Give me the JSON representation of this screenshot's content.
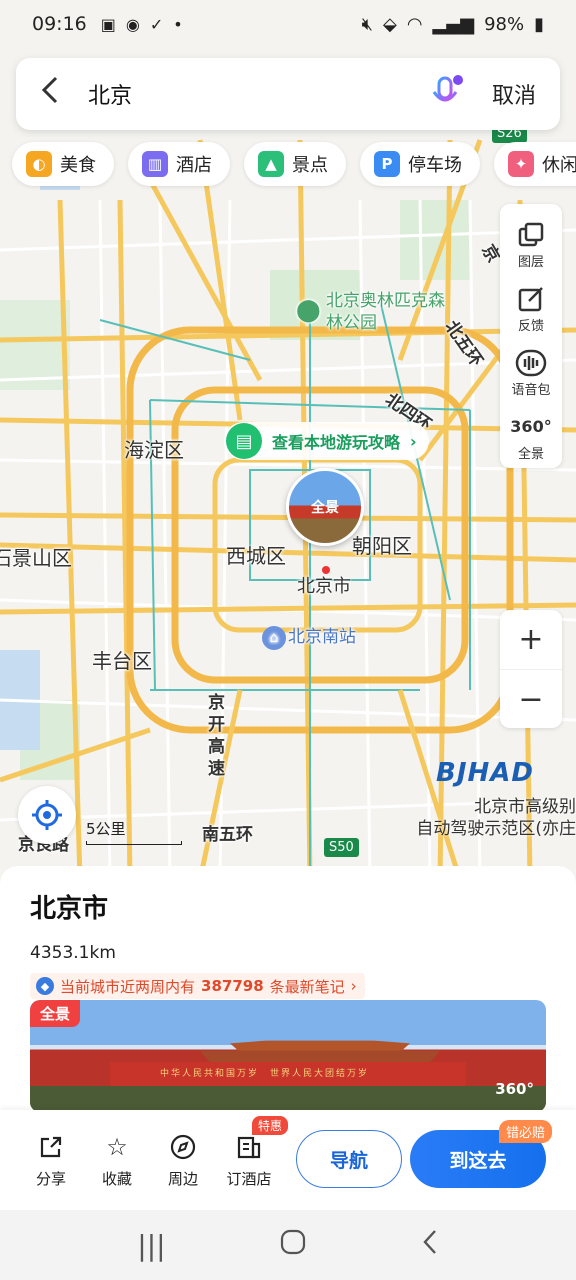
{
  "status_bar": {
    "time": "09:16",
    "battery": "98%",
    "icons": [
      "image-icon",
      "chat-icon",
      "check-icon",
      "dot-icon",
      "mute-icon",
      "location-icon",
      "wifi-icon",
      "signal-icon",
      "battery-icon"
    ]
  },
  "search": {
    "query": "北京",
    "cancel_label": "取消",
    "back_icon": "back-arrow-icon",
    "voice_icon": "mic-icon"
  },
  "categories": [
    {
      "label": "美食",
      "icon": "food-icon",
      "color": "#f5a623"
    },
    {
      "label": "酒店",
      "icon": "hotel-icon",
      "color": "#7b6cf0"
    },
    {
      "label": "景点",
      "icon": "scenic-icon",
      "color": "#2bbf7a"
    },
    {
      "label": "停车场",
      "icon": "parking-icon",
      "color": "#3a8cf2"
    },
    {
      "label": "休闲",
      "icon": "game-icon",
      "color": "#f0607e"
    }
  ],
  "tools": {
    "layers": "图层",
    "feedback": "反馈",
    "voice_pack": "语音包",
    "panorama": "全景",
    "panorama_badge": "360°"
  },
  "map": {
    "labels": {
      "forest_park": "北京奥林匹克森林公园",
      "north_5th_ring": "北五环",
      "north_4th_ring": "北四环",
      "haidian": "海淀区",
      "xicheng": "西城区",
      "chaoyang": "朝阳区",
      "shijingshan": "石景山区",
      "beijing_city": "北京市",
      "fengtai": "丰台区",
      "south_station": "北京南站",
      "jingkai": "京开高速",
      "south_5th_ring": "南五环",
      "jingliang": "京良路",
      "east_edge": "京",
      "s50": "S50",
      "s26": "S26"
    },
    "guide_text": "查看本地游玩攻略",
    "pano_label": "全景",
    "scale": "5公里",
    "bjhad_logo": "BJHAD",
    "bjhad_line1": "北京市高级别",
    "bjhad_line2": "自动驾驶示范区(亦庄"
  },
  "place": {
    "name": "北京市",
    "distance": "4353.1km",
    "notes_prefix": "当前城市近两周内有",
    "notes_count": "387798",
    "notes_suffix": "条最新笔记",
    "pano_tag": "全景",
    "pano_deg": "360°",
    "gate_text": "中华人民共和国万岁　世界人民大团结万岁"
  },
  "actions": {
    "share": "分享",
    "favorite": "收藏",
    "nearby": "周边",
    "book_hotel": "订酒店",
    "hotel_badge": "特惠",
    "navigate": "导航",
    "go_here": "到这去",
    "go_badge": "错必赔"
  }
}
